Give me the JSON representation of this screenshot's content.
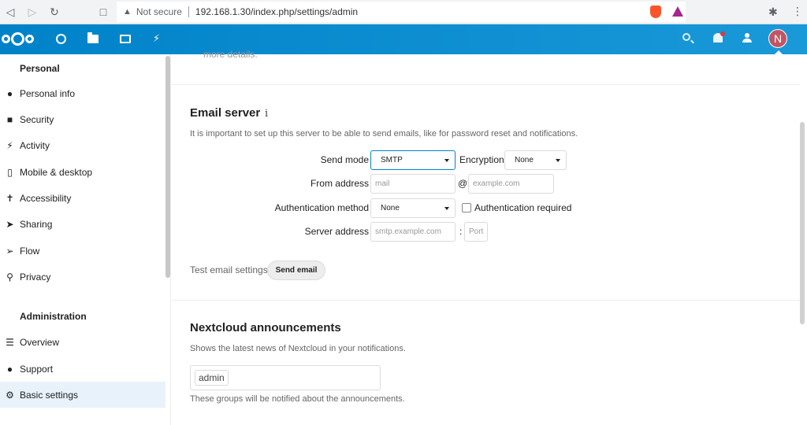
{
  "browser": {
    "url_warning": "Not secure",
    "url": "192.168.1.30/index.php/settings/admin"
  },
  "header": {
    "avatar_initial": "N"
  },
  "sidebar": {
    "personal_heading": "Personal",
    "personal_items": [
      {
        "label": "Personal info",
        "icon": "user-icon"
      },
      {
        "label": "Security",
        "icon": "lock-icon"
      },
      {
        "label": "Activity",
        "icon": "bolt-icon"
      },
      {
        "label": "Mobile & desktop",
        "icon": "phone-icon"
      },
      {
        "label": "Accessibility",
        "icon": "accessibility-icon"
      },
      {
        "label": "Sharing",
        "icon": "share-icon"
      },
      {
        "label": "Flow",
        "icon": "flow-icon"
      },
      {
        "label": "Privacy",
        "icon": "key-icon"
      }
    ],
    "admin_heading": "Administration",
    "admin_items": [
      {
        "label": "Overview",
        "icon": "list-icon"
      },
      {
        "label": "Support",
        "icon": "speech-bubble-icon"
      },
      {
        "label": "Basic settings",
        "icon": "gear-icon",
        "active": true
      }
    ]
  },
  "main": {
    "more_details": "more details.",
    "email": {
      "title": "Email server",
      "description": "It is important to set up this server to be able to send emails, like for password reset and notifications.",
      "send_mode_label": "Send mode",
      "send_mode_value": "SMTP",
      "encryption_label": "Encryption",
      "encryption_value": "None",
      "from_label": "From address",
      "from_placeholder": "mail",
      "at": "@",
      "domain_placeholder": "example.com",
      "auth_method_label": "Authentication method",
      "auth_method_value": "None",
      "auth_required_label": "Authentication required",
      "server_label": "Server address",
      "server_placeholder": "smtp.example.com",
      "colon": ":",
      "port_placeholder": "Port",
      "test_label": "Test email settings",
      "send_button": "Send email"
    },
    "announcements": {
      "title": "Nextcloud announcements",
      "description": "Shows the latest news of Nextcloud in your notifications.",
      "group_tag": "admin",
      "footer": "These groups will be notified about the announcements."
    }
  },
  "colors": {
    "header_blue": "#0082c9",
    "avatar": "#c05665",
    "active_item": "#e7f2fa"
  }
}
